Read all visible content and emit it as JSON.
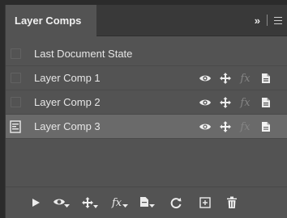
{
  "panel": {
    "title": "Layer Comps",
    "collapse_glyph": "»",
    "menu_icon": "hamburger-icon"
  },
  "rows": [
    {
      "label": "Last Document State",
      "selected": false,
      "icons": []
    },
    {
      "label": "Layer Comp 1",
      "selected": false,
      "icons": [
        "visibility-eye-icon",
        "position-move-icon",
        "fx-style-icon",
        "appearance-document-icon"
      ]
    },
    {
      "label": "Layer Comp 2",
      "selected": false,
      "icons": [
        "visibility-eye-icon",
        "position-move-icon",
        "fx-style-icon",
        "appearance-document-icon"
      ]
    },
    {
      "label": "Layer Comp 3",
      "selected": true,
      "icons": [
        "visibility-eye-icon",
        "position-move-icon",
        "fx-style-icon",
        "appearance-document-icon"
      ]
    }
  ],
  "footer": {
    "buttons": [
      "play-icon",
      "update-visibility-icon",
      "update-position-icon",
      "update-style-icon",
      "update-appearance-icon",
      "refresh-icon",
      "new-comp-icon",
      "trash-icon"
    ]
  },
  "colors": {
    "panel_bg": "#535353",
    "tab_bar_bg": "#393939",
    "selected_row": "#6a6a6a",
    "fx_dim": "#858585"
  }
}
